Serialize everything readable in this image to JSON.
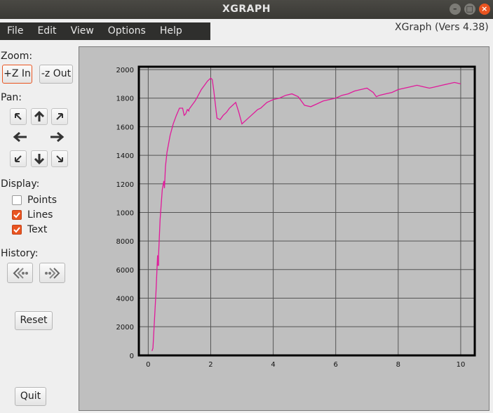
{
  "window": {
    "title": "XGRAPH",
    "minimize_glyph": "–",
    "maximize_glyph": "□",
    "close_glyph": "×"
  },
  "menu": {
    "items": [
      "File",
      "Edit",
      "View",
      "Options",
      "Help"
    ]
  },
  "version": "XGraph (Vers 4.38)",
  "controls": {
    "zoom_label": "Zoom:",
    "zoom_in": "+Z In",
    "zoom_out": "-z Out",
    "pan_label": "Pan:",
    "pan_icons": [
      "arrow-up-left-icon",
      "arrow-up-icon",
      "arrow-up-right-icon",
      "arrow-left-icon",
      "arrow-right-icon",
      "arrow-down-left-icon",
      "arrow-down-icon",
      "arrow-down-right-icon"
    ],
    "display_label": "Display:",
    "display_options": [
      {
        "label": "Points",
        "checked": false
      },
      {
        "label": "Lines",
        "checked": true
      },
      {
        "label": "Text",
        "checked": true
      }
    ],
    "history_label": "History:",
    "history_icons": [
      "history-back-icon",
      "history-forward-icon"
    ],
    "reset": "Reset",
    "quit": "Quit"
  },
  "colors": {
    "accent": "#e95420",
    "series": "#e0199a",
    "plot_bg": "#c0c0c0",
    "grid": "#555555"
  },
  "chart_data": {
    "type": "line",
    "title": "",
    "xlabel": "",
    "ylabel": "",
    "xlim": [
      -0.3,
      10.45
    ],
    "ylim": [
      -8,
      20200
    ],
    "grid": true,
    "x_ticks": [
      0,
      2,
      4,
      6,
      8,
      10
    ],
    "x_tick_labels": [
      "0",
      "2",
      "4",
      "6",
      "8",
      "10"
    ],
    "y_ticks": [
      0,
      2000,
      4000,
      6000,
      8000,
      10000,
      12000,
      14000,
      16000,
      18000,
      20000
    ],
    "y_tick_labels": [
      "0",
      "2000",
      "4000",
      "6000",
      "8000",
      "1000",
      "1200",
      "1400",
      "1600",
      "1800",
      "2000"
    ],
    "series": [
      {
        "x": [
          0.12,
          0.15,
          0.2,
          0.25,
          0.3,
          0.3,
          0.33,
          0.33,
          0.38,
          0.45,
          0.5,
          0.52,
          0.53,
          0.55,
          0.6,
          0.7,
          0.8,
          0.9,
          1.0,
          1.1,
          1.15,
          1.2,
          1.25,
          1.3,
          1.3,
          1.4,
          1.5,
          1.6,
          1.7,
          1.8,
          1.9,
          2.0,
          2.05,
          2.1,
          2.2,
          2.3,
          2.4,
          2.5,
          2.6,
          2.7,
          2.8,
          2.9,
          3.0,
          3.1,
          3.2,
          3.3,
          3.4,
          3.5,
          3.6,
          3.7,
          3.8,
          3.9,
          4.0,
          4.2,
          4.4,
          4.6,
          4.8,
          5.0,
          5.2,
          5.4,
          5.6,
          5.8,
          6.0,
          6.2,
          6.4,
          6.6,
          6.8,
          7.0,
          7.2,
          7.3,
          7.4,
          7.6,
          7.8,
          8.0,
          8.2,
          8.4,
          8.6,
          8.8,
          9.0,
          9.2,
          9.4,
          9.6,
          9.8,
          10.0
        ],
        "y": [
          300,
          500,
          2500,
          4500,
          7000,
          6300,
          6300,
          7000,
          9500,
          11600,
          12200,
          11700,
          12200,
          13200,
          14200,
          15400,
          16200,
          16800,
          17300,
          17300,
          16800,
          16900,
          17200,
          17100,
          17200,
          17500,
          17800,
          18200,
          18600,
          18900,
          19200,
          19400,
          19300,
          18500,
          16600,
          16500,
          16800,
          17000,
          17300,
          17500,
          17700,
          17000,
          16200,
          16400,
          16600,
          16800,
          17000,
          17200,
          17300,
          17500,
          17700,
          17800,
          17900,
          18000,
          18200,
          18300,
          18100,
          17500,
          17400,
          17600,
          17800,
          17900,
          18000,
          18200,
          18300,
          18500,
          18600,
          18700,
          18400,
          18100,
          18200,
          18300,
          18400,
          18600,
          18700,
          18800,
          18900,
          18800,
          18700,
          18800,
          18900,
          19000,
          19100,
          19000
        ]
      }
    ]
  }
}
